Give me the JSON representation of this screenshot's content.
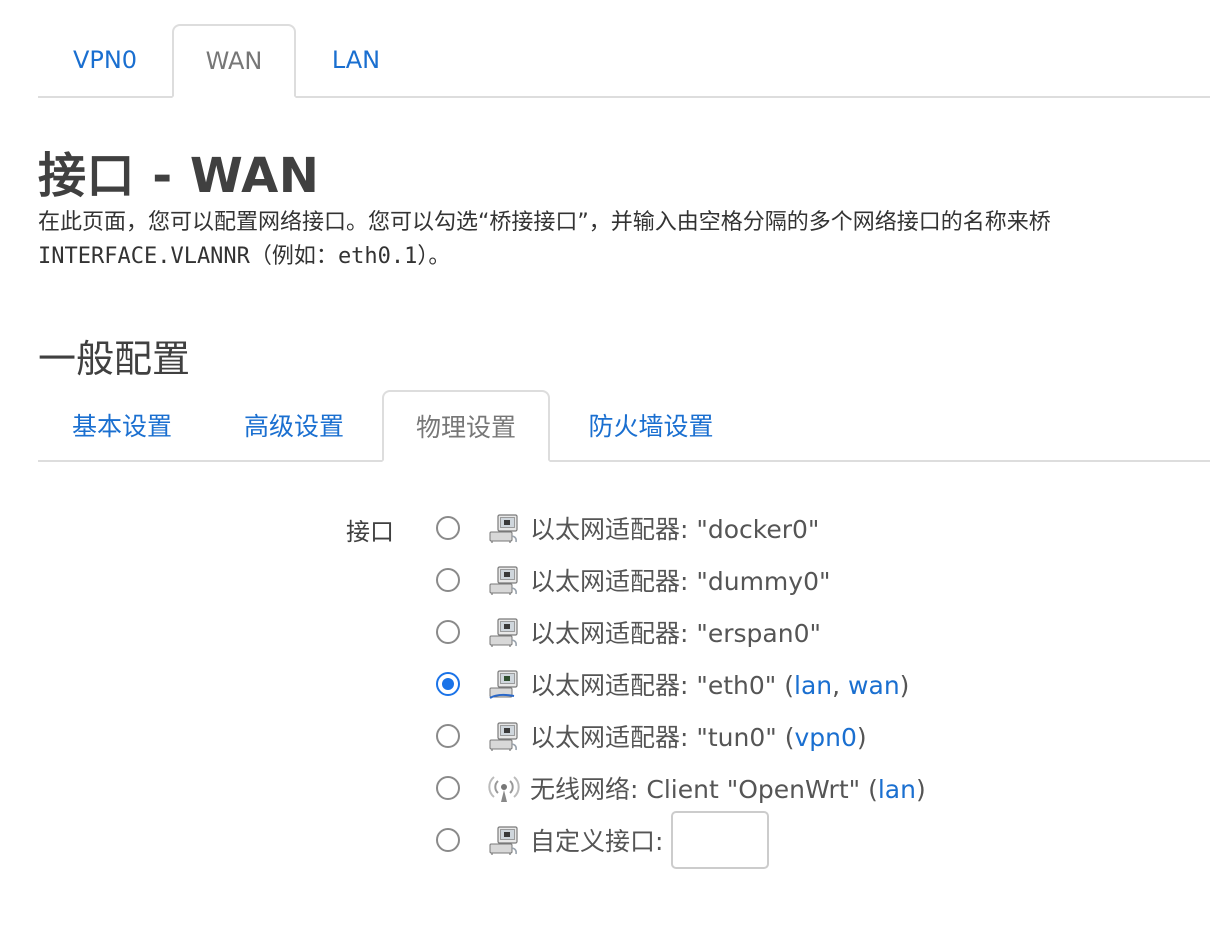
{
  "tabs": [
    {
      "label": "VPN0",
      "active": false
    },
    {
      "label": "WAN",
      "active": true
    },
    {
      "label": "LAN",
      "active": false
    }
  ],
  "page": {
    "title": "接口 - WAN",
    "description_line1": "在此页面，您可以配置网络接口。您可以勾选“桥接接口”，并输入由空格分隔的多个网络接口的名称来桥",
    "description_line2_code": "INTERFACE.VLANNR",
    "description_line2_rest": "（例如：",
    "description_line2_code2": "eth0.1",
    "description_line2_end": "）。"
  },
  "section": {
    "title": "一般配置",
    "tabs": [
      {
        "label": "基本设置",
        "active": false
      },
      {
        "label": "高级设置",
        "active": false
      },
      {
        "label": "物理设置",
        "active": true
      },
      {
        "label": "防火墙设置",
        "active": false
      }
    ]
  },
  "interface_field": {
    "label": "接口",
    "options": [
      {
        "text": "以太网适配器: \"docker0\"",
        "links": [],
        "checked": false,
        "icon": "ethernet-icon"
      },
      {
        "text": "以太网适配器: \"dummy0\"",
        "links": [],
        "checked": false,
        "icon": "ethernet-icon"
      },
      {
        "text": "以太网适配器: \"erspan0\"",
        "links": [],
        "checked": false,
        "icon": "ethernet-icon"
      },
      {
        "text": "以太网适配器: \"eth0\"",
        "links": [
          "lan",
          "wan"
        ],
        "checked": true,
        "icon": "ethernet-icon"
      },
      {
        "text": "以太网适配器: \"tun0\"",
        "links": [
          "vpn0"
        ],
        "checked": false,
        "icon": "ethernet-icon"
      },
      {
        "text": "无线网络: Client \"OpenWrt\"",
        "links": [
          "lan"
        ],
        "checked": false,
        "icon": "wireless-icon"
      },
      {
        "text": "自定义接口:",
        "links": [],
        "checked": false,
        "icon": "ethernet-icon",
        "custom_input_value": ""
      }
    ]
  },
  "colors": {
    "link": "#1a6fd0",
    "radio_checked": "#1a73e8",
    "tab_border": "#dddddd",
    "heading": "#404040"
  }
}
